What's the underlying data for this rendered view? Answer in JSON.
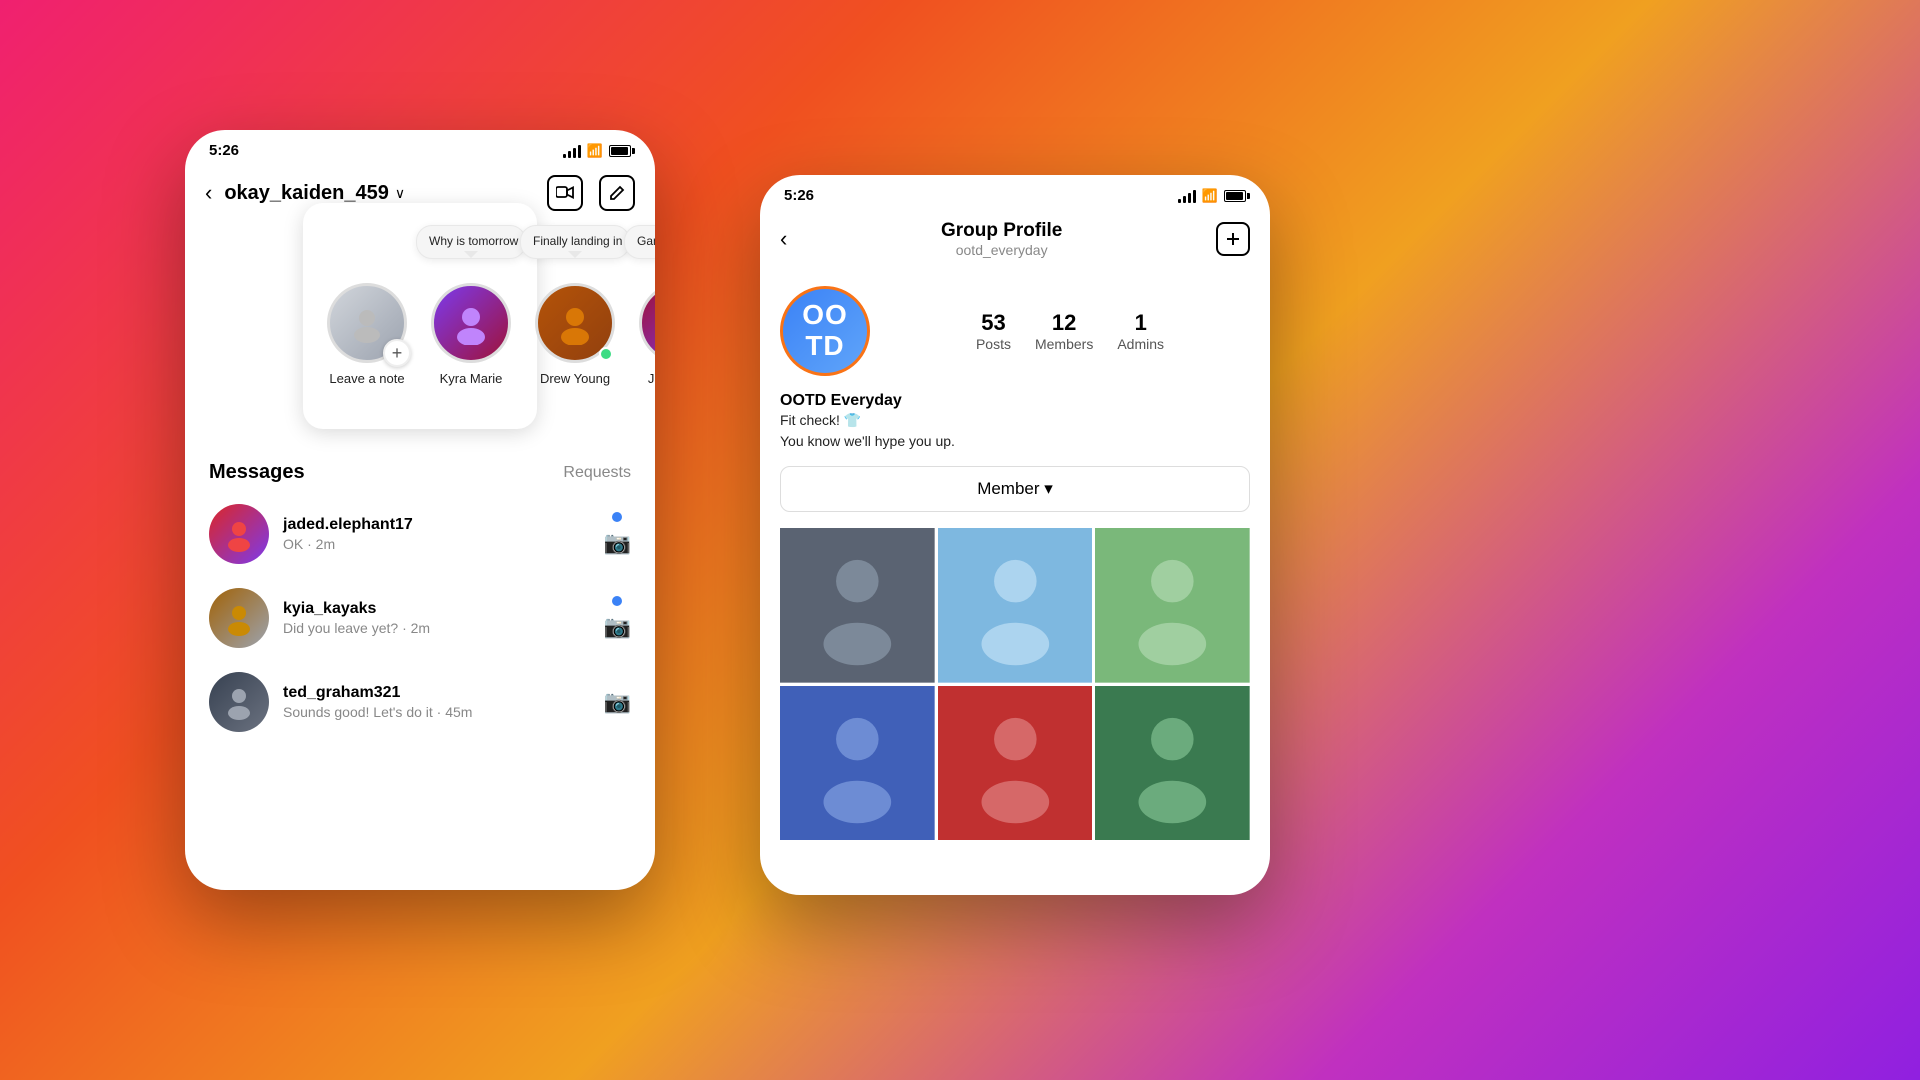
{
  "background": {
    "gradient": "linear-gradient(135deg, #f02070, #f05020, #f0a020, #c030c0, #9020e0)"
  },
  "left_phone": {
    "status_bar": {
      "time": "5:26"
    },
    "header": {
      "username": "okay_kaiden_459",
      "back_label": "‹",
      "video_icon": "video-camera",
      "edit_icon": "pencil"
    },
    "stories": [
      {
        "id": "self",
        "name": "Leave a note",
        "has_plus": true,
        "note": null,
        "online": false
      },
      {
        "id": "kyra",
        "name": "Kyra Marie",
        "has_plus": false,
        "note": "Why is tomorrow Monday!? 😩",
        "online": false
      },
      {
        "id": "drew",
        "name": "Drew Young",
        "has_plus": false,
        "note": "Finally landing in NYC! ❤️",
        "online": true
      },
      {
        "id": "jac",
        "name": "Jacqueline Lam",
        "has_plus": false,
        "note": "Game night this weekend? 🎱",
        "online": true
      }
    ],
    "messages_section": {
      "title": "Messages",
      "requests_label": "Requests"
    },
    "messages": [
      {
        "username": "jaded.elephant17",
        "preview": "OK · 2m",
        "unread": true
      },
      {
        "username": "kyia_kayaks",
        "preview": "Did you leave yet? · 2m",
        "unread": true
      },
      {
        "username": "ted_graham321",
        "preview": "Sounds good! Let's do it · 45m",
        "unread": false
      }
    ]
  },
  "right_phone": {
    "status_bar": {
      "time": "5:26"
    },
    "header": {
      "title": "Group Profile",
      "subtitle": "ootd_everyday",
      "back_label": "‹",
      "plus_icon": "plus-square"
    },
    "group": {
      "avatar_text_line1": "OO",
      "avatar_text_line2": "TD",
      "stats": {
        "posts_count": "53",
        "posts_label": "Posts",
        "members_count": "12",
        "members_label": "Members",
        "admins_count": "1",
        "admins_label": "Admins"
      },
      "bio_name": "OOTD Everyday",
      "bio_line1": "Fit check! 👕",
      "bio_line2": "You know we'll hype you up.",
      "member_button_label": "Member ▾"
    },
    "photos": [
      {
        "id": "p1",
        "color": "#6b7280"
      },
      {
        "id": "p2",
        "color": "#3b82f6"
      },
      {
        "id": "p3",
        "color": "#84cc16"
      },
      {
        "id": "p4",
        "color": "#2563eb"
      },
      {
        "id": "p5",
        "color": "#dc2626"
      },
      {
        "id": "p6",
        "color": "#16a34a"
      }
    ]
  }
}
